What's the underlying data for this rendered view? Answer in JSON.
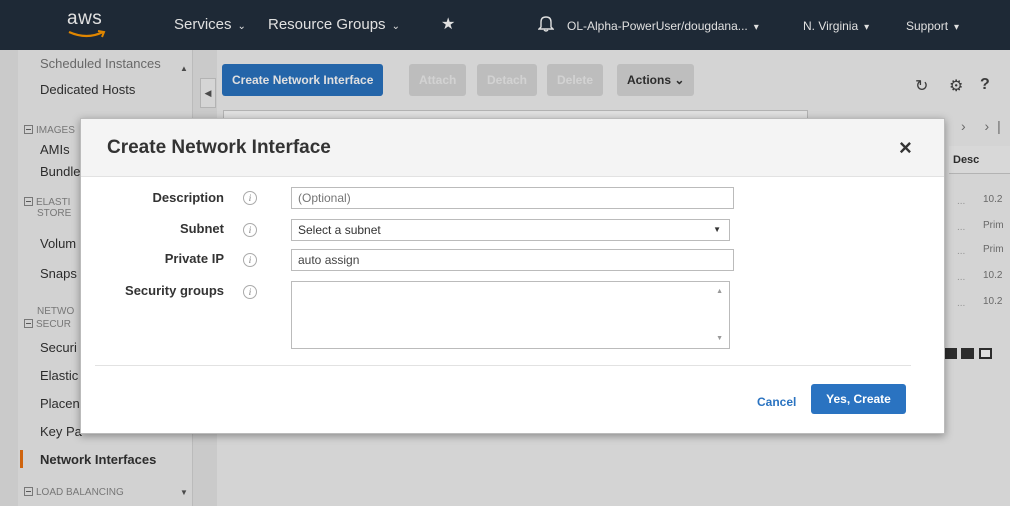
{
  "topnav": {
    "logo": "aws",
    "services": "Services",
    "resource_groups": "Resource Groups",
    "account": "OL-Alpha-PowerUser/dougdana...",
    "region": "N. Virginia",
    "support": "Support"
  },
  "sidebar": {
    "cut_item": "Scheduled Instances",
    "dedicated_hosts": "Dedicated Hosts",
    "sec_images": "IMAGES",
    "amis": "AMIs",
    "bundle": "Bundle",
    "sec_ebs_1": "ELASTI",
    "sec_ebs_2": "STORE",
    "volumes": "Volum",
    "snapshots": "Snaps",
    "sec_net_1": "NETWO",
    "sec_net_2": "SECUR",
    "security": "Securi",
    "elastic": "Elastic",
    "placement": "Placen",
    "keypairs": "Key Pa",
    "network_interfaces": "Network Interfaces",
    "sec_lb": "LOAD BALANCING"
  },
  "toolbar": {
    "create": "Create Network Interface",
    "attach": "Attach",
    "detach": "Detach",
    "delete": "Delete",
    "actions": "Actions"
  },
  "background": {
    "col_header": "Desc",
    "cells": [
      "10.2",
      "Prim",
      "Prim",
      "10.2",
      "10.2"
    ]
  },
  "modal": {
    "title": "Create Network Interface",
    "close": "×",
    "fields": {
      "description_label": "Description",
      "description_placeholder": "(Optional)",
      "subnet_label": "Subnet",
      "subnet_value": "Select a subnet",
      "private_ip_label": "Private IP",
      "private_ip_value": "auto assign",
      "security_groups_label": "Security groups"
    },
    "cancel": "Cancel",
    "create": "Yes, Create"
  }
}
